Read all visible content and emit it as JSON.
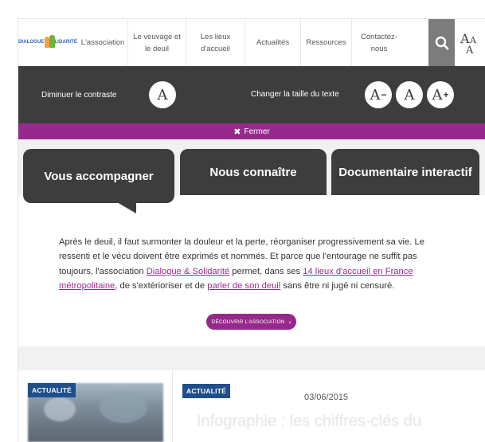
{
  "header": {
    "logo": {
      "word1": "DIALOGUE",
      "word2": "SOLIDARITÉ",
      "colors": [
        "#f3a33c",
        "#6db33f",
        "#2a5ea8"
      ]
    },
    "nav": [
      {
        "line1": "L'association",
        "line2": ""
      },
      {
        "line1": "Le veuvage et",
        "line2": "le deuil"
      },
      {
        "line1": "Les lieux",
        "line2": "d'accueil"
      },
      {
        "line1": "Actualités",
        "line2": ""
      },
      {
        "line1": "Ressources",
        "line2": ""
      },
      {
        "line1": "Contactez-nous",
        "line2": ""
      }
    ],
    "search_icon": "search-icon",
    "text_size_icon": "text-size-icon"
  },
  "a11y": {
    "contrast_label": "Diminuer le contraste",
    "contrast_btn": "A",
    "size_label": "Changer la taille du texte",
    "smaller_btn": "A",
    "smaller_sign": "−",
    "normal_btn": "A",
    "larger_btn": "A",
    "larger_sign": "+",
    "close_label": "Fermer",
    "close_glyph": "✖"
  },
  "tabs": [
    {
      "label": "Vous accompagner",
      "active": true
    },
    {
      "label": "Nous connaître",
      "active": false
    },
    {
      "label": "Documentaire interactif",
      "active": false
    }
  ],
  "intro": {
    "p1": "Après le deuil, il faut surmonter la douleur et la perte, réorganiser progressivement sa vie. Le ressenti et le vécu doivent être exprimés et nommés. Et parce que l'entourage ne suffit pas toujours, l'association ",
    "link1": "Dialogue & Solidarité",
    "p2": " permet, dans ses ",
    "link2": "14 lieux d'accueil en France métropolitaine",
    "p3": ", de s'extérioriser et de ",
    "link3": "parler de son deuil",
    "p4": " sans être ni jugé ni censuré."
  },
  "cta": {
    "label": "DÉCOUVRIR L'ASSOCIATION",
    "arrow": "›"
  },
  "news": {
    "badge1": "ACTUALITÉ",
    "badge2": "ACTUALITÉ",
    "date": "03/06/2015",
    "title": "Infographie : les chiffres-clés du"
  },
  "colors": {
    "accent": "#962a8c",
    "dark": "#3d3d3d",
    "badge": "#1f4f8a",
    "search_bg": "#7c7c7c"
  }
}
